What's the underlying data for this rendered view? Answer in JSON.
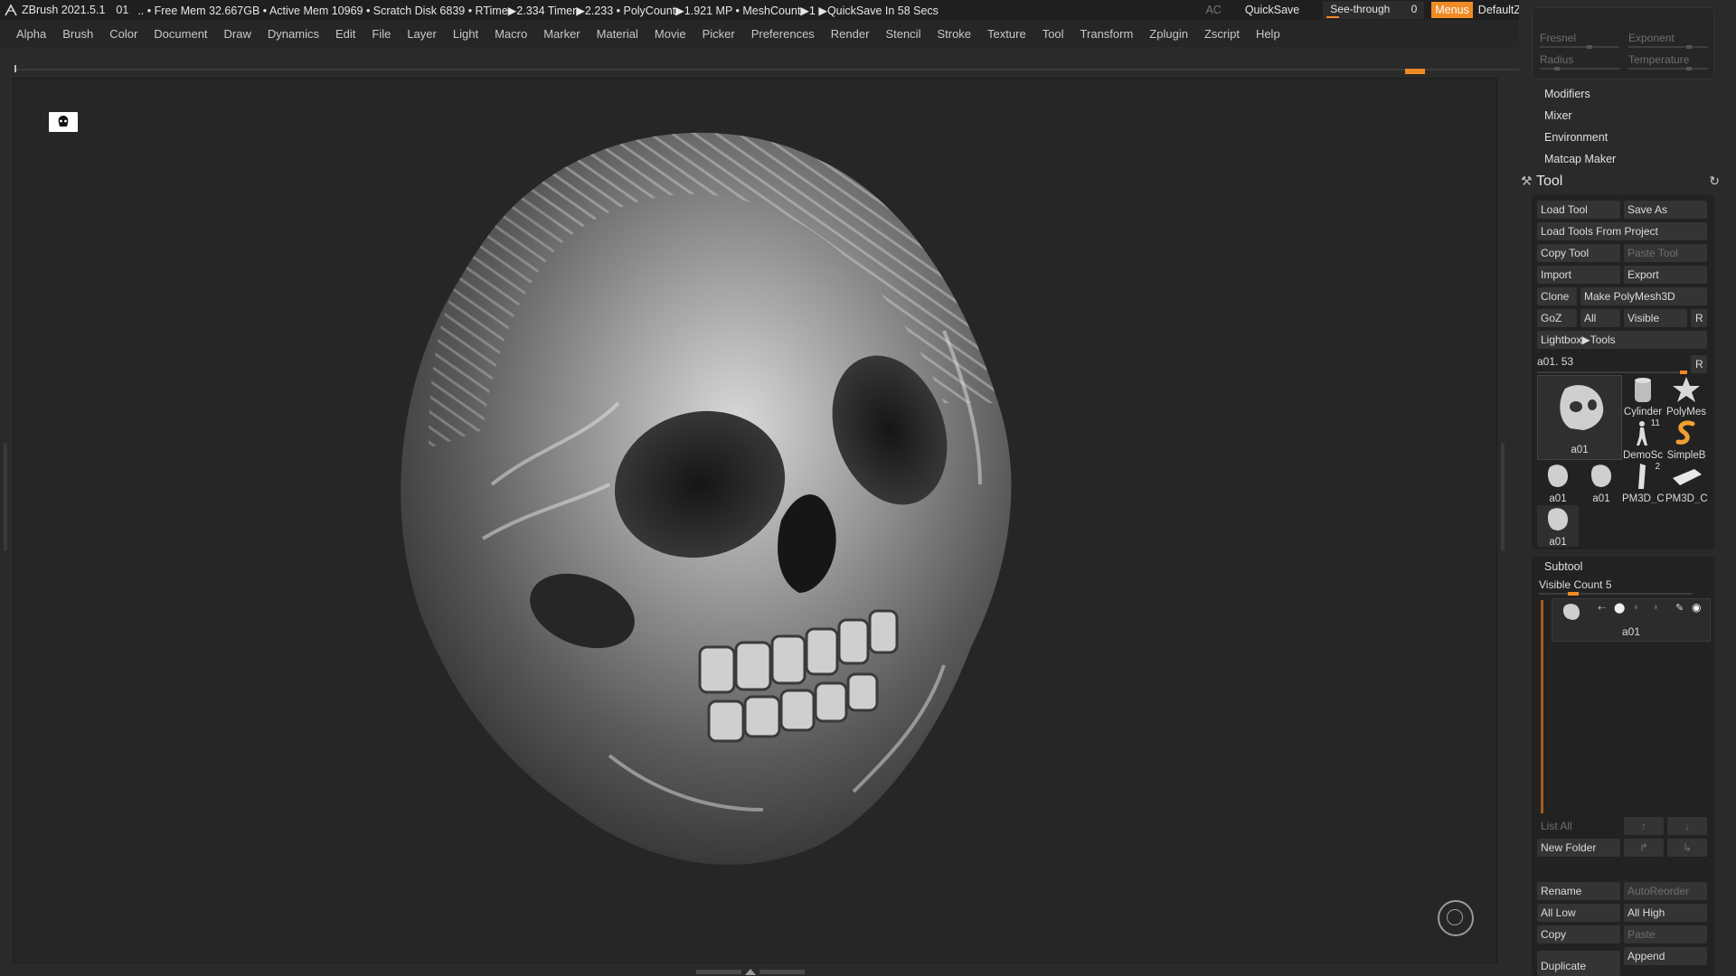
{
  "titlebar": {
    "app": "ZBrush 2021.5.1",
    "doc_num": "01",
    "stats": ".. • Free Mem 32.667GB • Active Mem 10969 • Scratch Disk 6839 • RTime▶2.334 Timer▶2.233 • PolyCount▶1.921 MP • MeshCount▶1 ▶QuickSave In 58 Secs",
    "ac": "AC",
    "quicksave": "QuickSave",
    "seethrough_label": "See-through",
    "seethrough_value": "0",
    "menus": "Menus",
    "script": "DefaultZScript",
    "accent": "#f08a24"
  },
  "menubar": [
    "Alpha",
    "Brush",
    "Color",
    "Document",
    "Draw",
    "Dynamics",
    "Edit",
    "File",
    "Layer",
    "Light",
    "Macro",
    "Marker",
    "Material",
    "Movie",
    "Picker",
    "Preferences",
    "Render",
    "Stencil",
    "Stroke",
    "Texture",
    "Tool",
    "Transform",
    "Zplugin",
    "Zscript",
    "Help"
  ],
  "light_panel": {
    "fresnel": "Fresnel",
    "exponent": "Exponent",
    "radius": "Radius",
    "temperature": "Temperature"
  },
  "subpalettes": [
    "Modifiers",
    "Mixer",
    "Environment",
    "Matcap Maker"
  ],
  "tool": {
    "title": "Tool",
    "load_tool": "Load Tool",
    "save_as": "Save As",
    "load_from_project": "Load Tools From Project",
    "copy_tool": "Copy Tool",
    "paste_tool": "Paste Tool",
    "import": "Import",
    "export": "Export",
    "clone": "Clone",
    "make_polymesh": "Make PolyMesh3D",
    "goz": "GoZ",
    "all": "All",
    "visible": "Visible",
    "r": "R",
    "lightbox_tools": "Lightbox▶Tools",
    "slider_label": "a01. 53",
    "thumbs": {
      "big": "a01",
      "cylinder": "Cylinder",
      "polymesh": "PolyMes",
      "demosoldier": "DemoSc",
      "simplebrush": "SimpleB",
      "small1": "a01",
      "small2": "a01",
      "pm3d1": "PM3D_C",
      "pm3d2": "PM3D_C",
      "small3": "a01",
      "badge_11": "11",
      "badge_2": "2"
    }
  },
  "subtool": {
    "title": "Subtool",
    "visible_count": "Visible Count 5",
    "item_name": "a01",
    "list_all": "List All",
    "new_folder": "New Folder",
    "rename": "Rename",
    "autoreorder": "AutoReorder",
    "all_low": "All Low",
    "all_high": "All High",
    "copy": "Copy",
    "paste": "Paste",
    "duplicate": "Duplicate",
    "append": "Append"
  }
}
